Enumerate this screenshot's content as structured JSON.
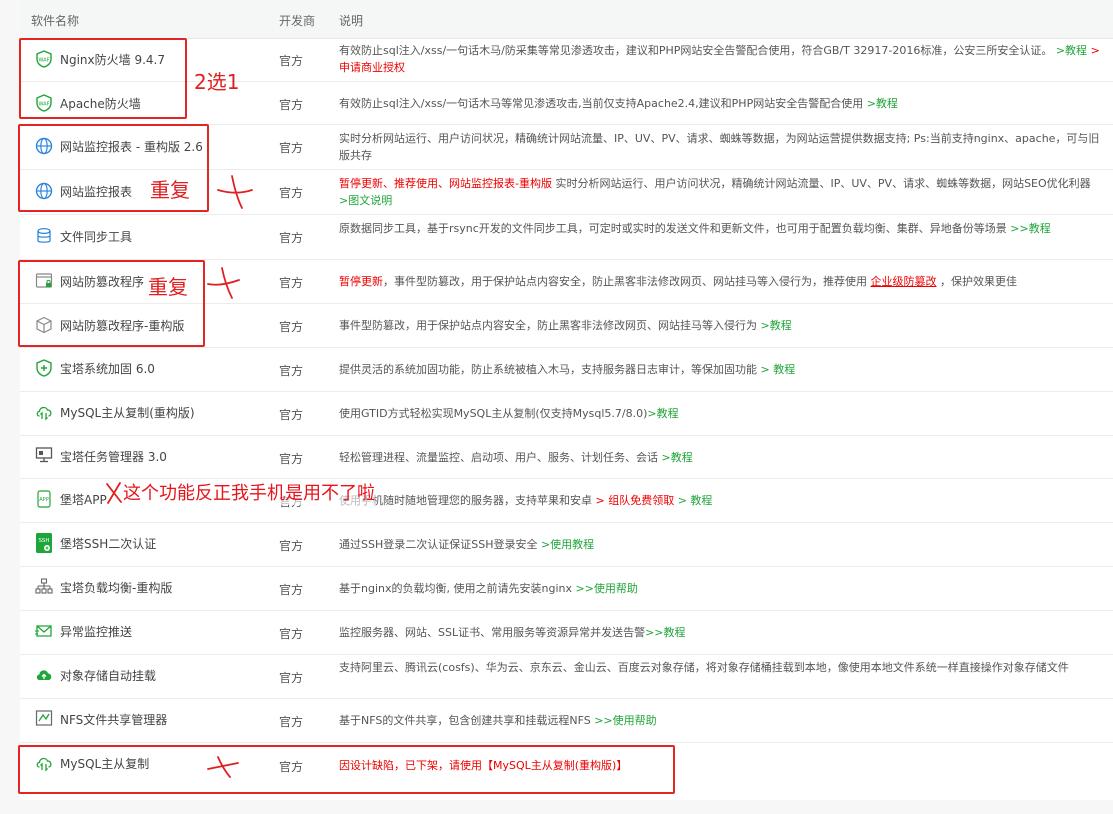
{
  "headers": {
    "name": "软件名称",
    "dev": "开发商",
    "desc": "说明"
  },
  "rows": [
    {
      "icon": "waf-icon",
      "name": "Nginx防火墙 9.4.7",
      "dev": "官方",
      "desc": "有效防止sql注入/xss/一句话木马/防采集等常见渗透攻击，建议和PHP网站安全告警配合使用，符合GB/T 32917-2016标准，公安三所安全认证。",
      "l1": " >教程 ",
      "l2": " >申请商业授权"
    },
    {
      "icon": "waf-icon",
      "name": "Apache防火墙",
      "dev": "官方",
      "desc": "有效防止sql注入/xss/一句话木马等常见渗透攻击,当前仅支持Apache2.4,建议和PHP网站安全告警配合使用 ",
      "l1": ">教程"
    },
    {
      "icon": "monitor-globe-icon",
      "name": "网站监控报表 - 重构版 2.6",
      "dev": "官方",
      "desc": "实时分析网站运行、用户访问状况，精确统计网站流量、IP、UV、PV、请求、蜘蛛等数据，为网站运营提供数据支持; Ps:当前支持nginx、apache，可与旧版共存"
    },
    {
      "icon": "monitor-globe-icon",
      "name": "网站监控报表",
      "dev": "官方",
      "r1": "暂停更新、推荐使用、",
      "r2": "网站监控报表-重构版",
      "desc": " 实时分析网站运行、用户访问状况，精确统计网站流量、IP、UV、PV、请求、蜘蛛等数据，网站SEO优化利器 ",
      "l1": ">图文说明"
    },
    {
      "icon": "database-icon",
      "name": "文件同步工具",
      "dev": "官方",
      "desc": "原数据同步工具，基于rsync开发的文件同步工具，可定时或实时的发送文件和更新文件，也可用于配置负载均衡、集群、异地备份等场景 ",
      "l1": ">>教程"
    },
    {
      "icon": "browser-lock-icon",
      "name": "网站防篡改程序",
      "dev": "官方",
      "r1": "暂停更新",
      "desc": "，事件型防篡改，用于保护站点内容安全，防止黑客非法修改网页、网站挂马等入侵行为，推荐使用 ",
      "r2": "企业级防篡改",
      "desc2": " ，保护效果更佳"
    },
    {
      "icon": "cube-icon",
      "name": "网站防篡改程序-重构版",
      "dev": "官方",
      "desc": "事件型防篡改，用于保护站点内容安全，防止黑客非法修改网页、网站挂马等入侵行为 ",
      "l1": ">教程"
    },
    {
      "icon": "shield-plus-icon",
      "name": "宝塔系统加固 6.0",
      "dev": "官方",
      "desc": "提供灵活的系统加固功能，防止系统被植入木马，支持服务器日志审计，等保加固功能 ",
      "l1": "> 教程"
    },
    {
      "icon": "cloud-sync-icon",
      "name": "MySQL主从复制(重构版)",
      "dev": "官方",
      "desc": "使用GTID方式轻松实现MySQL主从复制(仅支持Mysql5.7/8.0)",
      "l1": ">教程"
    },
    {
      "icon": "task-manager-icon",
      "name": "宝塔任务管理器 3.0",
      "dev": "官方",
      "desc": "轻松管理进程、流量监控、启动项、用户、服务、计划任务、会话 ",
      "l1": ">教程"
    },
    {
      "icon": "app-icon",
      "name": "堡塔APP",
      "dev": "官方",
      "desc": "使用手机随时随地管理您的服务器，支持苹果和安卓 ",
      "r1": "> 组队免费领取",
      "l1": " > 教程"
    },
    {
      "icon": "ssh-icon",
      "name": "堡塔SSH二次认证",
      "dev": "官方",
      "desc": "通过SSH登录二次认证保证SSH登录安全 ",
      "l1": ">使用教程"
    },
    {
      "icon": "load-balance-icon",
      "name": "宝塔负载均衡-重构版",
      "dev": "官方",
      "desc": "基于nginx的负载均衡, 使用之前请先安装nginx ",
      "l1": ">>使用帮助"
    },
    {
      "icon": "alert-push-icon",
      "name": "异常监控推送",
      "dev": "官方",
      "desc": "监控服务器、网站、SSL证书、常用服务等资源异常并发送告警",
      "l1": ">>教程"
    },
    {
      "icon": "cloud-storage-icon",
      "name": "对象存储自动挂载",
      "dev": "官方",
      "desc": "支持阿里云、腾讯云(cosfs)、华为云、京东云、金山云、百度云对象存储，将对象存储桶挂载到本地，像使用本地文件系统一样直接操作对象存储文件"
    },
    {
      "icon": "nfs-icon",
      "name": "NFS文件共享管理器",
      "dev": "官方",
      "desc": "基于NFS的文件共享，包含创建共享和挂载远程NFS ",
      "l1": ">>使用帮助"
    },
    {
      "icon": "cloud-sync-icon",
      "name": "MySQL主从复制",
      "dev": "官方",
      "r1": "因设计缺陷，已下架，请使用【MySQL主从复制(重构版)】"
    }
  ],
  "annotations": {
    "pick_one": "2选1",
    "dup1": "重复",
    "dup2": "重复",
    "app_note": "这个功能反正我手机是用不了啦"
  }
}
